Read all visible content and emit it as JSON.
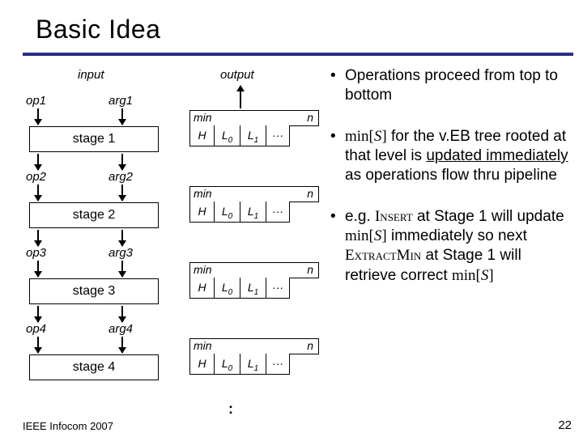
{
  "title": "Basic Idea",
  "footer": "IEEE Infocom 2007",
  "page_number": "22",
  "io": {
    "input": "input",
    "output": "output"
  },
  "ops": {
    "op1": "op1",
    "op2": "op2",
    "op3": "op3",
    "op4": "op4"
  },
  "args": {
    "arg1": "arg1",
    "arg2": "arg2",
    "arg3": "arg3",
    "arg4": "arg4"
  },
  "stages": {
    "s1": "stage 1",
    "s2": "stage 2",
    "s3": "stage 3",
    "s4": "stage 4"
  },
  "block": {
    "min": "min",
    "n": "n",
    "H": "H",
    "L0": "L",
    "L0s": "0",
    "L1": "L",
    "L1s": "1",
    "dots": "···"
  },
  "vdots": ":",
  "bullets": {
    "b1": "Operations proceed from top to bottom",
    "b2a": "min[",
    "b2S": "S",
    "b2b": "]",
    "b2c": " for the v.EB tree rooted at that level is ",
    "b2d": "updated immediately",
    "b2e": " as operations flow thru pipeline",
    "b3a": "e.g. ",
    "b3ins": "Insert",
    "b3b": " at Stage 1 will update ",
    "b3c": "min[",
    "b3S": "S",
    "b3d": "]",
    "b3e": " immediately so next ",
    "b3ex": "ExtractMin",
    "b3f": " at Stage 1 will retrieve correct ",
    "b3g": "min[",
    "b3S2": "S",
    "b3h": "]"
  }
}
